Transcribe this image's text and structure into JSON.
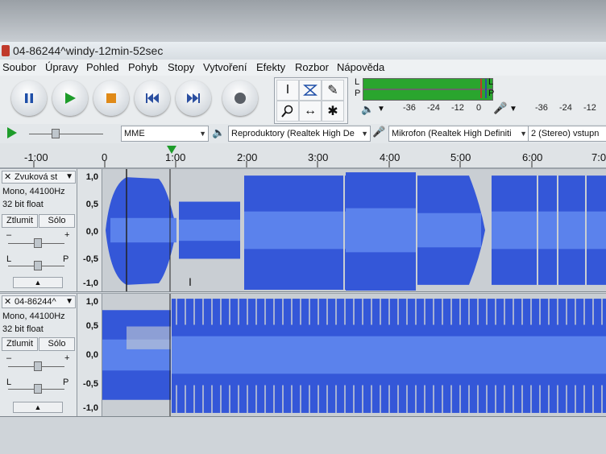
{
  "window": {
    "title": "04-86244^windy-12min-52sec"
  },
  "menu": [
    "Soubor",
    "Úpravy",
    "Pohled",
    "Pohyb",
    "Stopy",
    "Vytvoření",
    "Efekty",
    "Rozbor",
    "Nápověda"
  ],
  "meters": {
    "play_channels": [
      "L",
      "P"
    ],
    "scale_left": [
      "-36",
      "-24",
      "-12",
      "0"
    ],
    "scale_right": [
      "-36",
      "-24",
      "-12"
    ]
  },
  "devices": {
    "host": "MME",
    "output": "Reproduktory (Realtek High De",
    "input": "Mikrofon (Realtek High Definiti",
    "channels": "2 (Stereo) vstupn"
  },
  "timeline": [
    "-1:00",
    "0",
    "1:00",
    "2:00",
    "3:00",
    "4:00",
    "5:00",
    "6:00",
    "7:0"
  ],
  "tracks": [
    {
      "name": "Zvuková st",
      "format": "Mono, 44100Hz",
      "depth": "32 bit float",
      "mute": "Ztlumit",
      "solo": "Sólo",
      "gain_minus": "–",
      "gain_plus": "+",
      "pan_left": "L",
      "pan_right": "P",
      "y_labels": [
        "1,0",
        "0,5",
        "0,0",
        "-0,5",
        "-1,0"
      ]
    },
    {
      "name": "04-86244^",
      "format": "Mono, 44100Hz",
      "depth": "32 bit float",
      "mute": "Ztlumit",
      "solo": "Sólo",
      "gain_minus": "–",
      "gain_plus": "+",
      "pan_left": "L",
      "pan_right": "P",
      "y_labels": [
        "1,0",
        "0,5",
        "0,0",
        "-0,5",
        "-1,0"
      ]
    }
  ],
  "colors": {
    "wave": "#3457d8",
    "wave_rms": "#5b82ec",
    "meter": "#2aa52e",
    "menubar": "#eef1f3"
  }
}
